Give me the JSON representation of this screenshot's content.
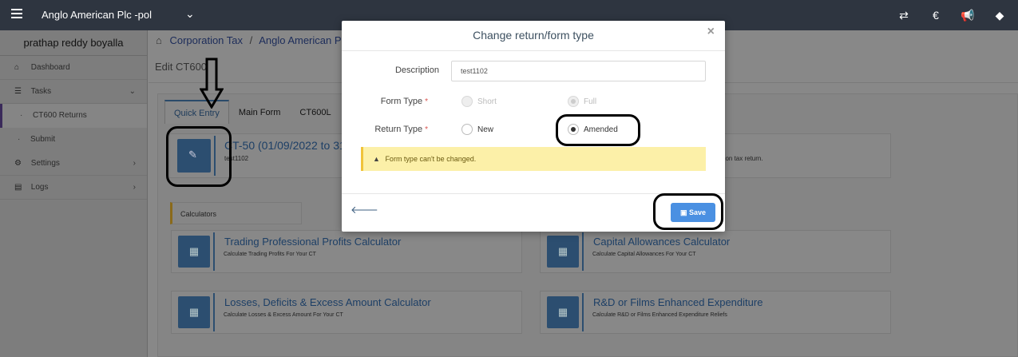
{
  "topbar": {
    "company": "Anglo American Plc -pol",
    "icons": [
      "exchange-icon",
      "euro-icon",
      "bullhorn-icon",
      "tag-icon"
    ]
  },
  "sidebar": {
    "user_name": "prathap reddy boyalla",
    "items": [
      {
        "label": "Dashboard",
        "icon": "home-icon"
      },
      {
        "label": "Tasks",
        "icon": "tasks-icon"
      },
      {
        "label": "CT600 Returns",
        "icon": "dot"
      },
      {
        "label": "Submit",
        "icon": "dot"
      },
      {
        "label": "Settings",
        "icon": "gear-icon"
      },
      {
        "label": "Logs",
        "icon": "file-icon"
      }
    ]
  },
  "breadcrumb": {
    "first": "Corporation Tax",
    "sep": "/",
    "second": "Anglo American Plc -p"
  },
  "page_title": "Edit CT600",
  "tabs": [
    "Quick Entry",
    "Main Form",
    "CT600L"
  ],
  "quick_entry": {
    "title": "CT-50 (01/09/2022 to 31/0",
    "sub": "test1102",
    "note": "ation tax return."
  },
  "calculators": {
    "label": "Calculators",
    "items": [
      {
        "title": "Trading Professional Profits Calculator",
        "sub": "Calculate Trading Profits For Your CT"
      },
      {
        "title": "Capital Allowances Calculator",
        "sub": "Calculate Capital Allowances For Your CT"
      },
      {
        "title": "Losses, Deficits & Excess Amount Calculator",
        "sub": "Calculate Losses & Excess Amount For Your CT"
      },
      {
        "title": "R&D or Films Enhanced Expenditure",
        "sub": "Calculate R&D or Films Enhanced Expenditure Reliefs"
      }
    ]
  },
  "modal": {
    "title": "Change return/form type",
    "close": "×",
    "description_label": "Description",
    "description_value": "test1102",
    "form_type_label": "Form Type",
    "form_type_options": [
      "Short",
      "Full"
    ],
    "form_type_selected": "Full",
    "return_type_label": "Return Type",
    "return_type_options": [
      "New",
      "Amended"
    ],
    "return_type_selected": "Amended",
    "required_mark": "*",
    "alert": "Form type can't be changed.",
    "save_label": "Save"
  }
}
